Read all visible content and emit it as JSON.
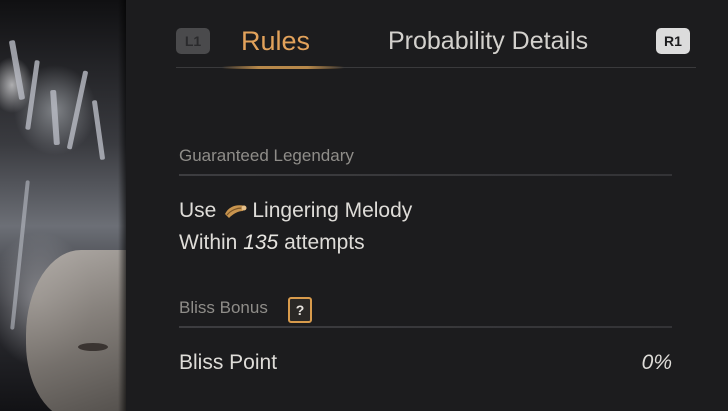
{
  "tabs": {
    "left_shoulder": "L1",
    "right_shoulder": "R1",
    "items": [
      {
        "label": "Rules",
        "active": true
      },
      {
        "label": "Probability Details",
        "active": false
      }
    ]
  },
  "guaranteed": {
    "title": "Guaranteed Legendary",
    "line1_prefix": "Use",
    "item_name": "Lingering Melody",
    "item_icon": "horn-icon",
    "line2_prefix": "Within",
    "attempts": "135",
    "line2_suffix": "attempts"
  },
  "bliss": {
    "title": "Bliss Bonus",
    "help_label": "?",
    "point_label": "Bliss Point",
    "point_value": "0%"
  },
  "colors": {
    "accent": "#e2a25b",
    "background": "#1c1c1e",
    "text": "#dedcd8",
    "muted": "#8f8d89"
  }
}
